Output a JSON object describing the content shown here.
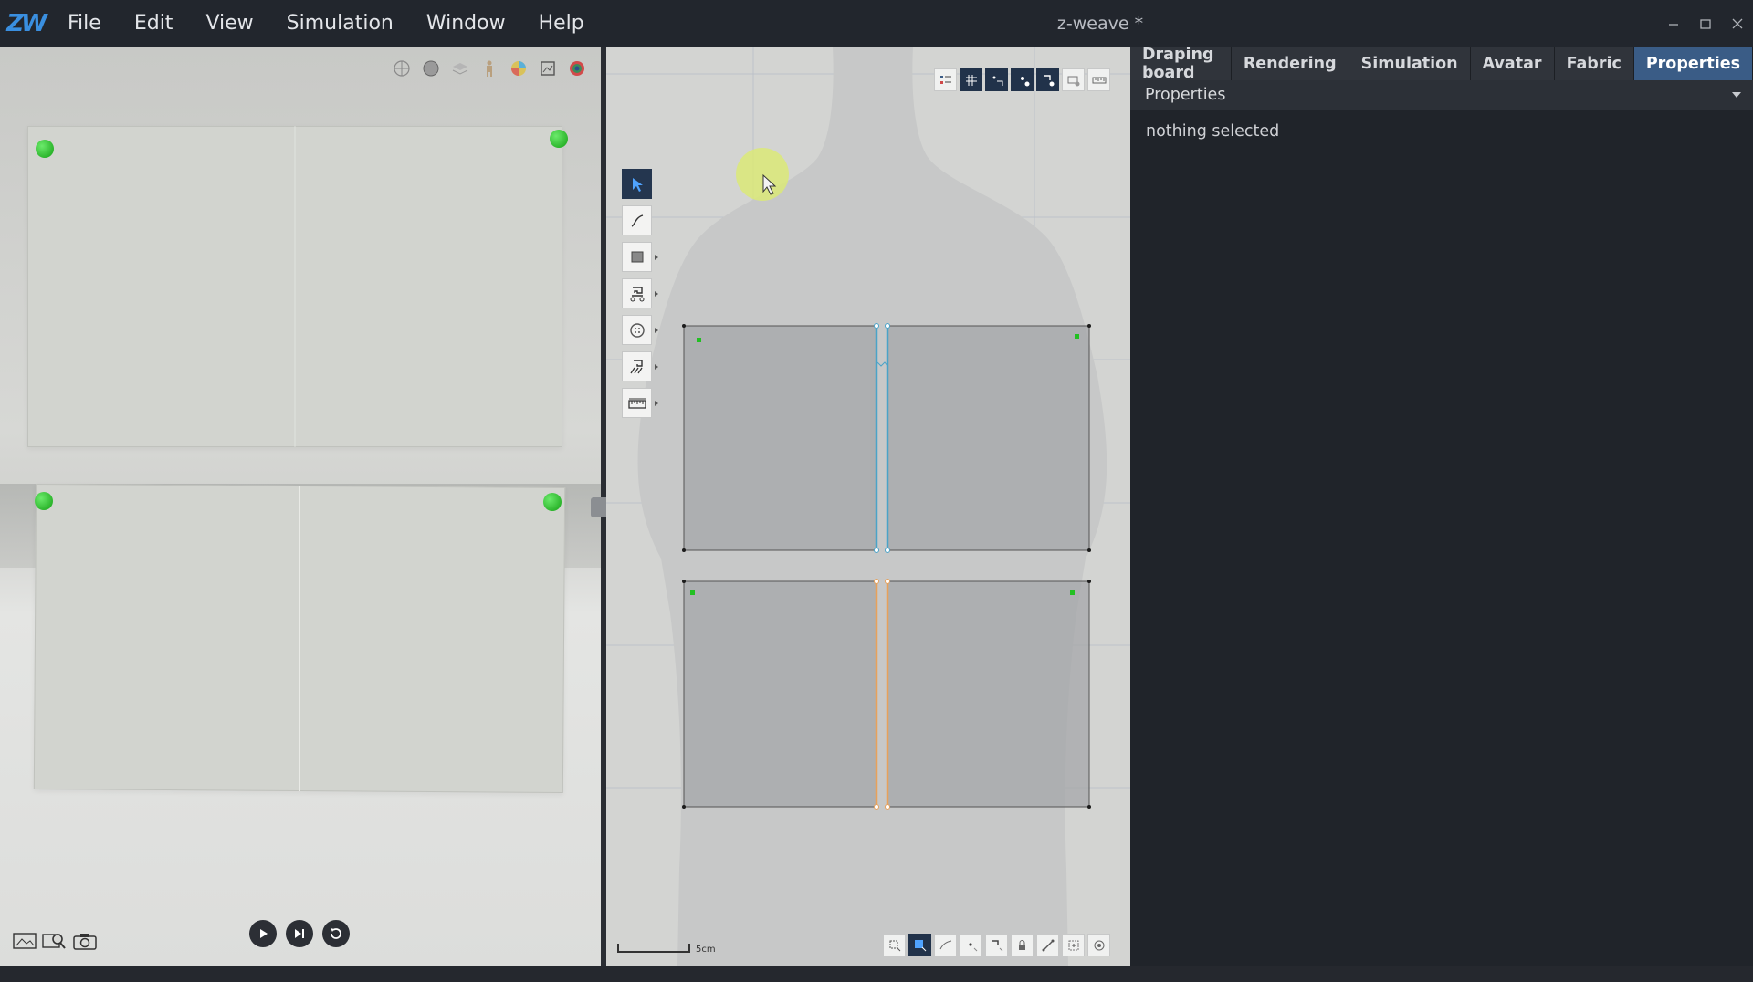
{
  "app": {
    "logo_text": "ZW",
    "title": "z-weave *"
  },
  "menu": [
    "File",
    "Edit",
    "View",
    "Simulation",
    "Window",
    "Help"
  ],
  "window_controls": [
    "minimize-icon",
    "maximize-icon",
    "close-icon"
  ],
  "viewport3d": {
    "toolbar_icons": [
      "wireframe-icon",
      "shaded-sphere-icon",
      "fabric-layer-icon",
      "avatar-icon",
      "color-wheel-icon",
      "texture-icon",
      "render-icon"
    ],
    "bottom_icons": [
      "screenshot-icon",
      "zoom-image-icon",
      "camera-icon"
    ],
    "playback_icons": [
      "play-icon",
      "step-forward-icon",
      "reset-icon"
    ]
  },
  "pattern2d": {
    "top_toolbar_icons": [
      "list-icon",
      "grid-icon",
      "points-icon",
      "pin-icon",
      "seam-icon",
      "layer-icon",
      "ruler-icon"
    ],
    "tools": [
      "select-tool-icon",
      "curve-tool-icon",
      "rectangle-tool-icon",
      "sewing-tool-icon",
      "button-tool-icon",
      "edit-sewing-icon",
      "measure-tool-icon"
    ],
    "bottom_toolbar_icons": [
      "transform-icon",
      "fill-icon",
      "line-icon",
      "point-icon",
      "seam-display-icon",
      "lock-icon",
      "internal-line-icon",
      "notch-icon",
      "target-icon"
    ],
    "scale_label": "5cm",
    "colors": {
      "seam_blue": "#4aa3c8",
      "seam_orange": "#e8a15a",
      "pattern_fill": "#a3a4a6",
      "cursor_highlight": "#d8e86a"
    }
  },
  "right_panel": {
    "tabs": [
      "Draping board",
      "Rendering",
      "Simulation",
      "Avatar",
      "Fabric",
      "Properties"
    ],
    "active_tab": "Properties",
    "header": "Properties",
    "body_text": "nothing selected"
  },
  "accent_color": "#3a5c86"
}
